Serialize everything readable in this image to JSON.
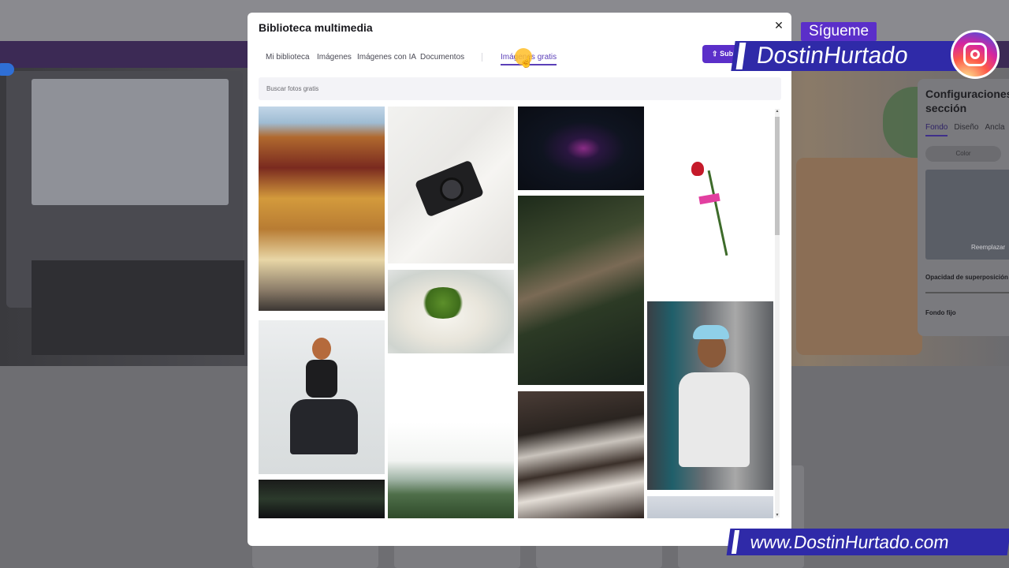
{
  "modal": {
    "title": "Biblioteca multimedia",
    "close_icon": "close-icon",
    "tabs": [
      {
        "label": "Mi biblioteca",
        "active": false
      },
      {
        "label": "Imágenes",
        "active": false
      },
      {
        "label": "Imágenes con IA",
        "active": false
      },
      {
        "label": "Documentos",
        "active": false
      },
      {
        "label": "Imágenes gratis",
        "active": true
      }
    ],
    "upload_button": {
      "label": "Subir",
      "icon": "upload-icon"
    },
    "search": {
      "placeholder": "Buscar fotos gratis",
      "value": ""
    },
    "images": [
      {
        "name": "temple"
      },
      {
        "name": "camera"
      },
      {
        "name": "food-plate"
      },
      {
        "name": "mountain"
      },
      {
        "name": "jellyfish"
      },
      {
        "name": "motion-blur"
      },
      {
        "name": "beach-waves"
      },
      {
        "name": "rose"
      },
      {
        "name": "man-cap"
      },
      {
        "name": "woman-sitting"
      },
      {
        "name": "dark-lights"
      },
      {
        "name": "sky"
      }
    ]
  },
  "settings_panel": {
    "title": "Configuraciones sección",
    "tabs": [
      "Fondo",
      "Diseño",
      "Ancla"
    ],
    "color_label": "Color",
    "replace_label": "Reemplazar",
    "opacity_label": "Opacidad de superposición",
    "fixed_bg_label": "Fondo fijo"
  },
  "overlay": {
    "follow_label": "Sígueme",
    "handle": "DostinHurtado",
    "website": "www.DostinHurtado.com"
  },
  "colors": {
    "accent": "#5b2fc9",
    "tab_active": "#5b3fb8",
    "banner": "#2f2aa8"
  }
}
